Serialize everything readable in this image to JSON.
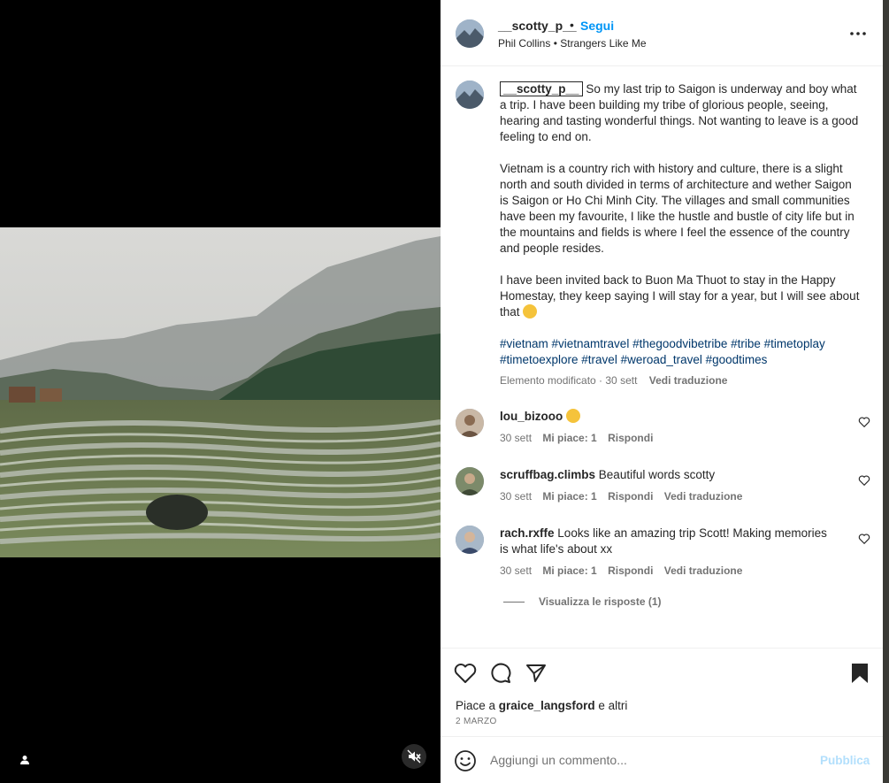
{
  "post": {
    "author": "__scotty_p__",
    "dot": "•",
    "follow_label": "Segui",
    "song": "Phil Collins • Strangers Like Me"
  },
  "caption": {
    "author": "__scotty_p__",
    "p1": "So my last trip to Saigon is underway and boy what a trip. I have been building my tribe of glorious people, seeing, hearing and tasting wonderful things. Not wanting to leave is a good feeling to end on.",
    "p2": "Vietnam is a country rich with history and culture, there is a slight north and south divided in terms of architecture and wether Saigon is Saigon or Ho Chi Minh City. The villages and small communities have been my favourite, I like the hustle and bustle of city life but in the mountains and fields is where I feel the essence of the country and people resides.",
    "p3": "I have been invited back to Buon Ma Thuot to stay in the Happy Homestay, they keep saying I will stay for a year, but I will see about that",
    "hashtags": "#vietnam #vietnamtravel #thegoodvibetribe #tribe #timetoplay #timetoexplore #travel #weroad_travel #goodtimes",
    "edited": "Elemento modificato · 30 sett",
    "see_translation": "Vedi traduzione"
  },
  "comments": [
    {
      "user": "lou_bizooo",
      "text": "",
      "time": "30 sett",
      "likes": "Mi piace: 1",
      "reply": "Rispondi",
      "translate": ""
    },
    {
      "user": "scruffbag.climbs",
      "text": "Beautiful words scotty",
      "time": "30 sett",
      "likes": "Mi piace: 1",
      "reply": "Rispondi",
      "translate": "Vedi traduzione"
    },
    {
      "user": "rach.rxffe",
      "text": "Looks like an amazing trip Scott! Making memories is what life's about xx",
      "time": "30 sett",
      "likes": "Mi piace: 1",
      "reply": "Rispondi",
      "translate": "Vedi traduzione"
    }
  ],
  "view_replies": "Visualizza le risposte (1)",
  "likes": {
    "prefix": "Piace a ",
    "user": "graice_langsford",
    "suffix": " e altri"
  },
  "date": "2 MARZO",
  "comment_box": {
    "placeholder": "Aggiungi un commento...",
    "publish": "Pubblica"
  },
  "icons": {
    "more": "more-horizontal-icon",
    "like": "heart-icon",
    "comment": "comment-icon",
    "share": "share-icon",
    "save": "bookmark-filled-icon",
    "emoji": "emoji-icon",
    "mute": "muted-speaker-icon",
    "user_tag": "person-icon"
  },
  "colors": {
    "link_blue": "#0095f6",
    "hashtag_blue": "#00376b",
    "muted_text": "#737373",
    "publish_disabled": "#b2dffc"
  }
}
